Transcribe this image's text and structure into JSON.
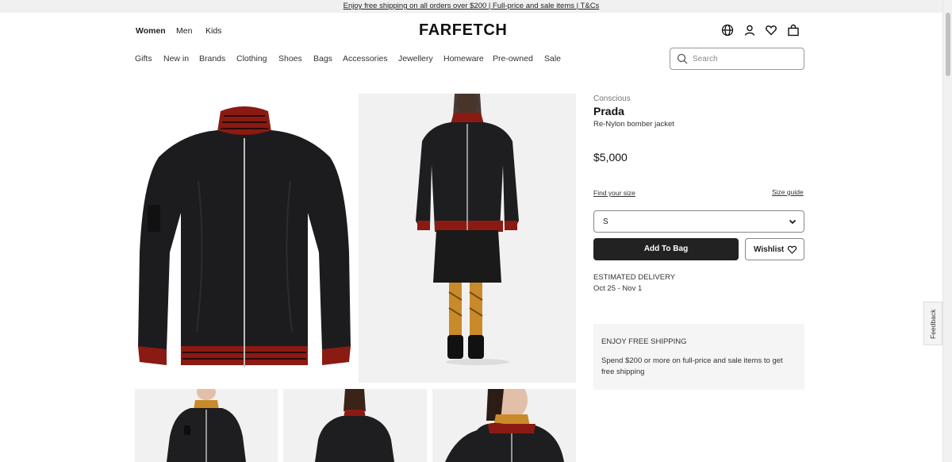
{
  "promo": {
    "text": "Enjoy free shipping on all orders over $200 | Full-price and sale items | T&Cs"
  },
  "header": {
    "genders": [
      "Women",
      "Men",
      "Kids"
    ],
    "logo": "FARFETCH",
    "icons": [
      "globe-icon",
      "account-icon",
      "wishlist-heart-icon",
      "bag-icon"
    ]
  },
  "nav": {
    "items": [
      "Gifts",
      "New in",
      "Brands",
      "Clothing",
      "Shoes",
      "Bags",
      "Accessories",
      "Jewellery",
      "Homeware",
      "Pre-owned",
      "Sale"
    ]
  },
  "search": {
    "placeholder": "Search",
    "value": ""
  },
  "product": {
    "tag": "Conscious",
    "brand": "Prada",
    "name": "Re-Nylon bomber jacket",
    "price": "$5,000",
    "find_size": "Find your size",
    "size_guide": "Size guide",
    "selected_size": "S",
    "add_to_bag": "Add To Bag",
    "wishlist": "Wishlist",
    "delivery_label": "ESTIMATED DELIVERY",
    "delivery_dates": "Oct 25 - Nov 1"
  },
  "shipping": {
    "heading": "ENJOY FREE SHIPPING",
    "text": "Spend $200 or more on full-price and sale items to get free shipping"
  },
  "feedback": {
    "label": "Feedback"
  },
  "colors": {
    "accent": "#222222",
    "jacket": "#1c1c1e",
    "trim": "#8b1a12",
    "panel": "#f5f5f5"
  }
}
